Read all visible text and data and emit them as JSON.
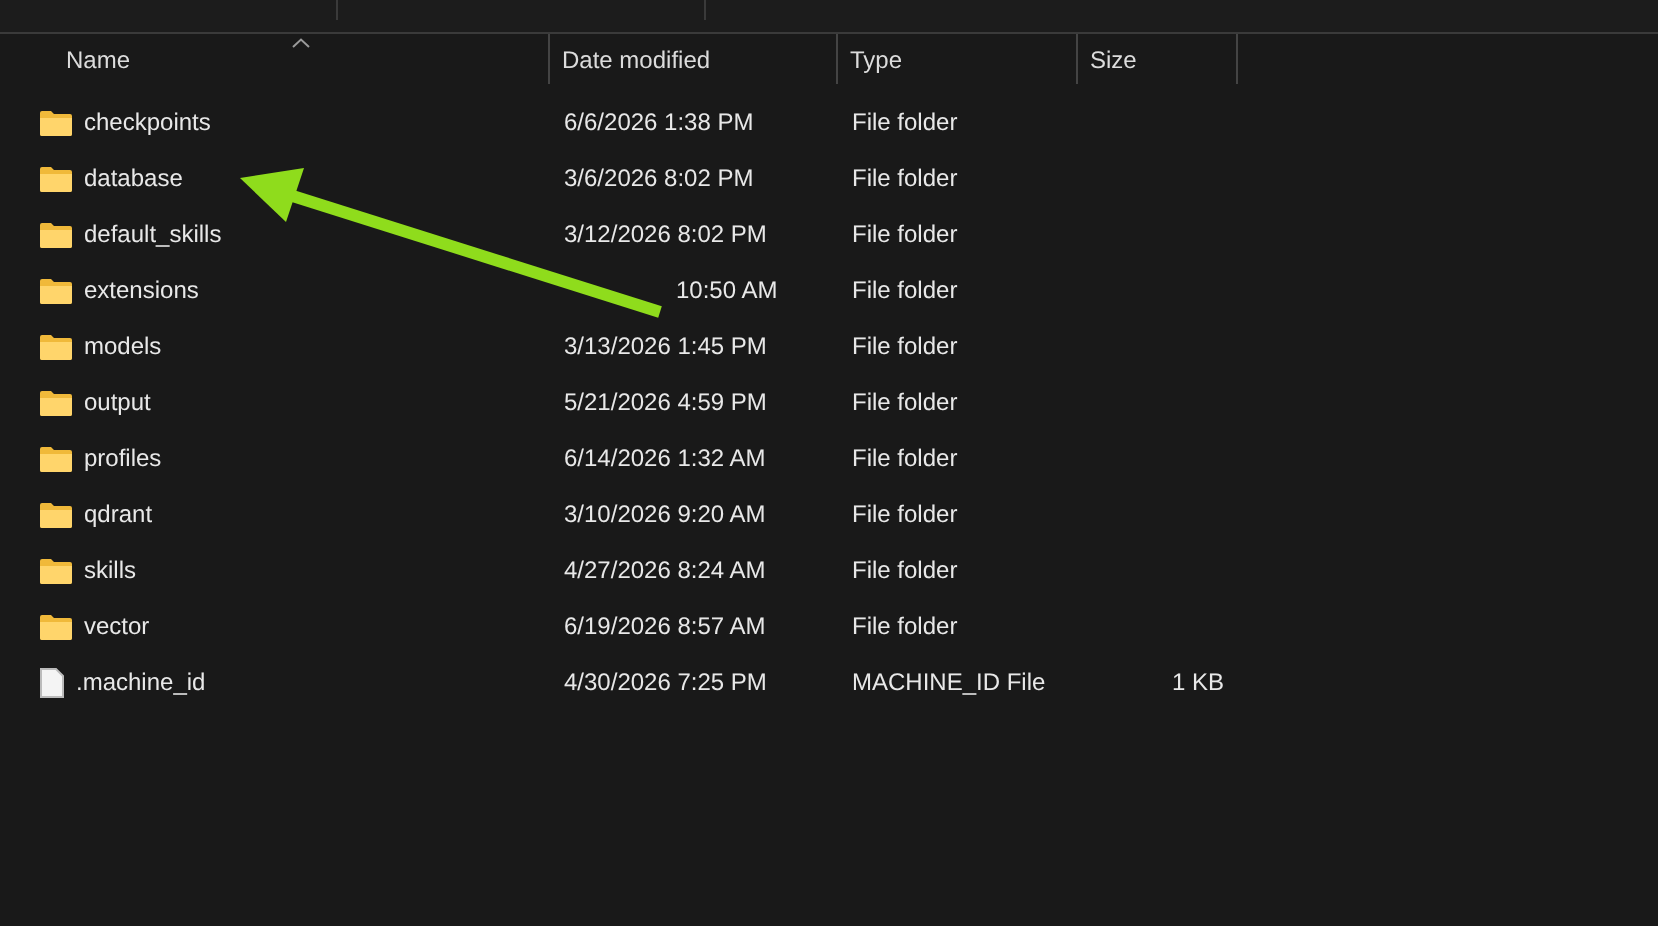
{
  "columns": [
    "Name",
    "Date modified",
    "Type",
    "Size"
  ],
  "rows": [
    {
      "kind": "folder",
      "name": "checkpoints",
      "date": "6/6/2026 1:38 PM",
      "type": "File folder"
    },
    {
      "kind": "folder",
      "name": "database",
      "date": "3/6/2026 8:02 PM",
      "type": "File folder"
    },
    {
      "kind": "folder",
      "name": "default_skills",
      "date": "3/12/2026 8:02 PM",
      "type": "File folder"
    },
    {
      "kind": "folder",
      "name": "extensions",
      "date": "10:50 AM",
      "date_partly_covered": true,
      "type": "File folder"
    },
    {
      "kind": "folder",
      "name": "models",
      "date": "3/13/2026 1:45 PM",
      "type": "File folder"
    },
    {
      "kind": "folder",
      "name": "output",
      "date": "5/21/2026 4:59 PM",
      "type": "File folder"
    },
    {
      "kind": "folder",
      "name": "profiles",
      "date": "6/14/2026 1:32 AM",
      "type": "File folder"
    },
    {
      "kind": "folder",
      "name": "qdrant",
      "date": "3/10/2026 9:20 AM",
      "type": "File folder"
    },
    {
      "kind": "folder",
      "name": "skills",
      "date": "4/27/2026 8:24 AM",
      "type": "File folder"
    },
    {
      "kind": "folder",
      "name": "vector",
      "date": "6/19/2026 8:57 AM",
      "type": "File folder"
    },
    {
      "kind": "file",
      "name": ".machine_id",
      "date": "4/30/2026 7:25 PM",
      "type": "MACHINE_ID File",
      "size": "1 KB"
    }
  ]
}
